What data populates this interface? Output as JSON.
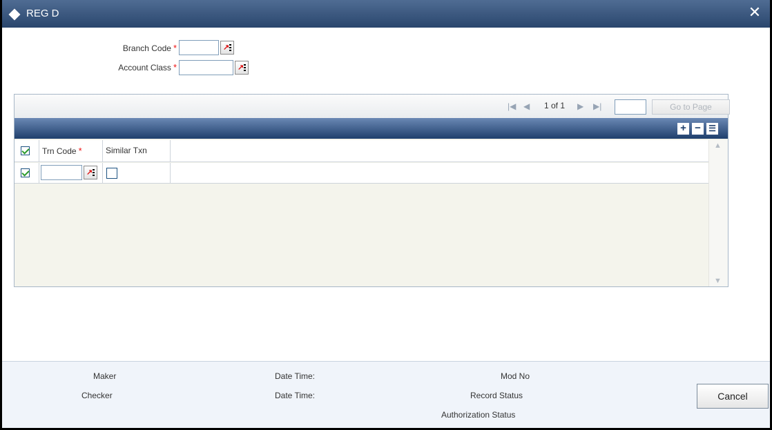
{
  "window": {
    "title": "REG D",
    "close_symbol": "✕"
  },
  "form": {
    "branch_code": {
      "label": "Branch Code",
      "required": "*",
      "value": ""
    },
    "account_class": {
      "label": "Account Class",
      "required": "*",
      "value": ""
    }
  },
  "grid": {
    "pager": {
      "page_text": "1 of 1",
      "page_input": "",
      "goto_label": "Go to Page"
    },
    "columns": [
      {
        "label": "Trn Code",
        "required": "*"
      },
      {
        "label": "Similar Txn"
      }
    ],
    "rows": [
      {
        "selected": true,
        "trn_code": "",
        "similar_txn": false
      }
    ]
  },
  "footer": {
    "maker": "Maker",
    "checker": "Checker",
    "date_time_1": "Date Time:",
    "date_time_2": "Date Time:",
    "mod_no": "Mod No",
    "record_status": "Record Status",
    "authorization_status": "Authorization Status",
    "cancel": "Cancel"
  },
  "icons": {
    "lov": "lov-icon",
    "first": "first-page-icon",
    "prev": "previous-page-icon",
    "next": "next-page-icon",
    "last": "last-page-icon",
    "add": "add-row-icon",
    "delete": "delete-row-icon",
    "single_view": "single-view-icon"
  }
}
